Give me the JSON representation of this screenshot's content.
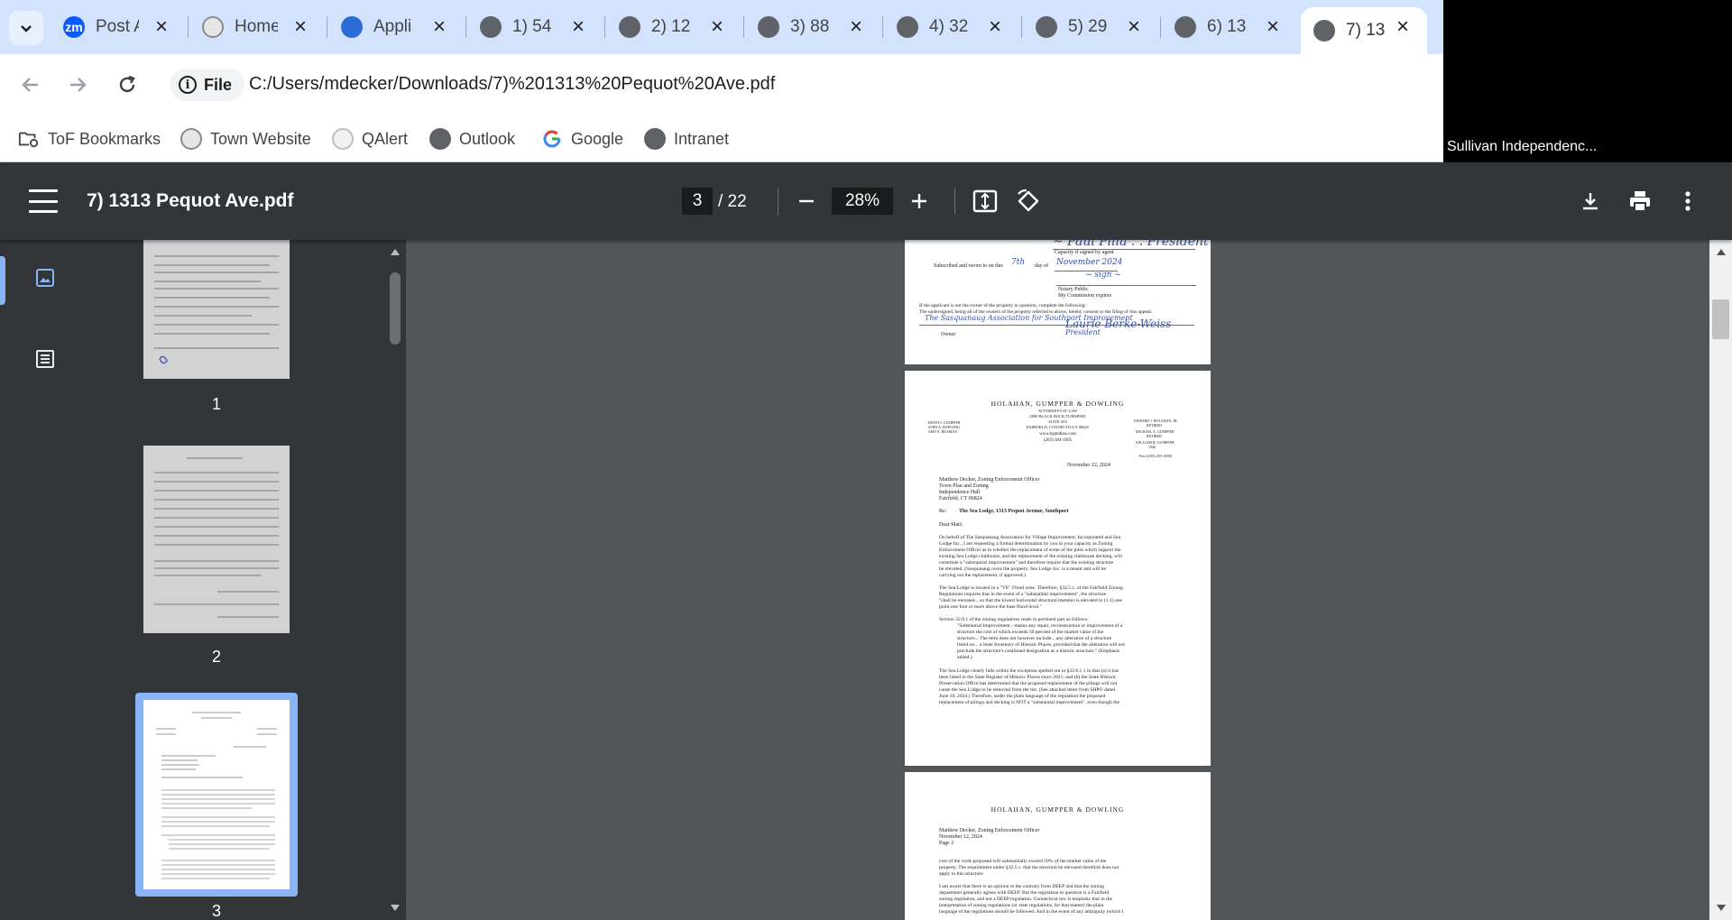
{
  "browser": {
    "tabs": [
      {
        "title": "Post A",
        "favicon": "zoom-icon"
      },
      {
        "title": "Home",
        "favicon": "town-seal-icon"
      },
      {
        "title": "Appli",
        "favicon": "shield-icon"
      },
      {
        "title": "1) 54",
        "favicon": "globe-icon"
      },
      {
        "title": "2) 12",
        "favicon": "globe-icon"
      },
      {
        "title": "3) 88",
        "favicon": "globe-icon"
      },
      {
        "title": "4) 32",
        "favicon": "globe-icon"
      },
      {
        "title": "5) 29",
        "favicon": "globe-icon"
      },
      {
        "title": "6) 13",
        "favicon": "globe-icon"
      },
      {
        "title": "7) 13",
        "favicon": "globe-icon",
        "active": true
      }
    ],
    "address": {
      "chip_label": "File",
      "url": "C:/Users/mdecker/Downloads/7)%201313%20Pequot%20Ave.pdf"
    },
    "bookmarks": [
      {
        "label": "ToF Bookmarks",
        "icon": "folder-gear-icon"
      },
      {
        "label": "Town Website",
        "icon": "town-seal-icon"
      },
      {
        "label": "QAlert",
        "icon": "town-seal-icon"
      },
      {
        "label": "Outlook",
        "icon": "globe-icon"
      },
      {
        "label": "Google",
        "icon": "google-icon"
      },
      {
        "label": "Intranet",
        "icon": "globe-icon"
      }
    ]
  },
  "video": {
    "participant": "Sullivan Independenc..."
  },
  "pdf": {
    "title": "7) 1313 Pequot Ave.pdf",
    "current_page": "3",
    "total_pages": "/ 22",
    "zoom": "28%",
    "thumbnails": [
      {
        "number": "1"
      },
      {
        "number": "2"
      },
      {
        "number": "3",
        "selected": true
      }
    ],
    "page_top": {
      "capacity": "Capacity if signed by agent",
      "subscribed": "Subscribed and sworn to on this",
      "day": "7th",
      "day_of": "day of",
      "month": "November 2024",
      "notary": "Notary Public",
      "commission": "My Commission expires",
      "not_owner": "If the applicant is not the owner of the property in question, complete the following:",
      "undersigned": "The undersigned, being all of the owners of the property referred to above, hereby consent to the filing of this appeal.",
      "association": "The Sasquanaug Association for Southport Improvement",
      "owner": "Owner",
      "president": "President",
      "signature": "Laurie Berke-Weiss"
    },
    "letter": {
      "firm": "HOLAHAN, GUMPPER & DOWLING",
      "subfirm": "ATTORNEYS AT LAW",
      "addr1": "2800 BLACK ROCK TURNPIKE",
      "addr2": "SUITE 203",
      "addr3": "FAIRFIELD, CONNECTICUT 06825",
      "web": "www.hgandlaw.com",
      "phone": "(203) 384-1995",
      "left_names": [
        "KEITH J. GUMPPER",
        "JOHN A. DOWLING",
        "AMY E. BEAMAN"
      ],
      "right_names": [
        "EDWARD J. HOLAHAN, JR.",
        "RETIRED",
        "MICHAEL A. GUMPPER",
        "RETIRED",
        "WILLIAM H. GUMPPER",
        "1946"
      ],
      "fax": "Fax (203) 255-3084",
      "date": "November 12, 2024",
      "recipient": [
        "Matthew Decker, Zoning Enforcement Officer",
        "Town Plan and Zoning",
        "Independence Hall",
        "Fairfield, CT 06824"
      ],
      "re_label": "Re:",
      "re_text": "The Sea Lodge, 1313 Pequot Avenue, Southport",
      "salutation": "Dear Matt:",
      "p1": [
        "On behalf of The Sasquanaug Association for Village Improvement, Incorporated and Sea",
        "Lodge Inc., I am requesting a formal determination by you in your capacity as Zoning",
        "Enforcement Officer as to whether the replacement of some of the piles which support the",
        "existing Sea Lodge clubhouse, and the replacement of the existing clubhouse decking, will",
        "constitute a \"substantial improvement\" and therefore require that the existing structure",
        "be elevated. (Sasquanaug owns the property. Sea Lodge Inc. is a tenant and will be",
        "carrying out the replacement, if approved.)"
      ],
      "p2": [
        "The Sea Lodge is located in a \"VE\" Flood zone. Therefore, §32.5 c. of the Fairfield Zoning",
        "Regulations requires that in the event of a \"substantial improvement\", the structure",
        "\"shall be elevated... so that the lowest horizontal structural member is elevated to (1.1) one",
        "point one foot or more above the base flood level.\""
      ],
      "p3": [
        "Section 32.8.1 of the zoning regulations reads in pertinent part as follows:",
        "\"Substantial Improvement - means any repair, reconstruction or improvement of a",
        "structure the cost of which exceeds 50 percent of the market value of the",
        "structure... The term does not however include... any alteration of a structure",
        "listed on... a State Inventory of Historic Places, provided that the alteration will not",
        "preclude the structure's continued designation as a historic structure.\" (Emphasis",
        "added.)"
      ],
      "p4": [
        "The Sea Lodge clearly falls within the exception spelled out in §32.8.1.1 in that (a) it has",
        "been listed in the State Register of Historic Places since 2021; and (b) the State Historic",
        "Preservation Office has determined that the proposed replacement of the pilings will not",
        "cause the Sea Lodge to be removed from the list. (See attached letter from SHPO dated",
        "June 10, 2024.) Therefore, under the plain language of the regulation the proposed",
        "replacement of pilings and decking is NOT a \"substantial improvement\", even though the"
      ]
    },
    "letter_p2": {
      "firm": "HOLAHAN, GUMPPER & DOWLING",
      "header": [
        "Matthew Decker, Zoning Enforcement Officer",
        "November 12, 2024",
        "Page 2"
      ],
      "p1": [
        "cost of the work proposed will substantially exceed 50% of the market value of the",
        "property. The requirement under §32.5 c. that the structure be elevated therefore does not",
        "apply to this structure."
      ],
      "p2": [
        "I am aware that there is an opinion to the contrary from DEEP and that the zoning",
        "department generally agrees with DEEP. But the regulation in question is a Fairfield",
        "zoning regulation, and not a DEEP regulation. Connecticut law is emphatic that in the",
        "interpretation of zoning regulations (or state regulations, for that matter) the plain",
        "language of the regulations should be followed. And in the event of any ambiguity (which I"
      ]
    }
  },
  "colors": {
    "tab_strip": "#d3e3fd",
    "viewer_bg": "#525659",
    "toolbar": "#323639",
    "accent": "#8ab4f8"
  }
}
